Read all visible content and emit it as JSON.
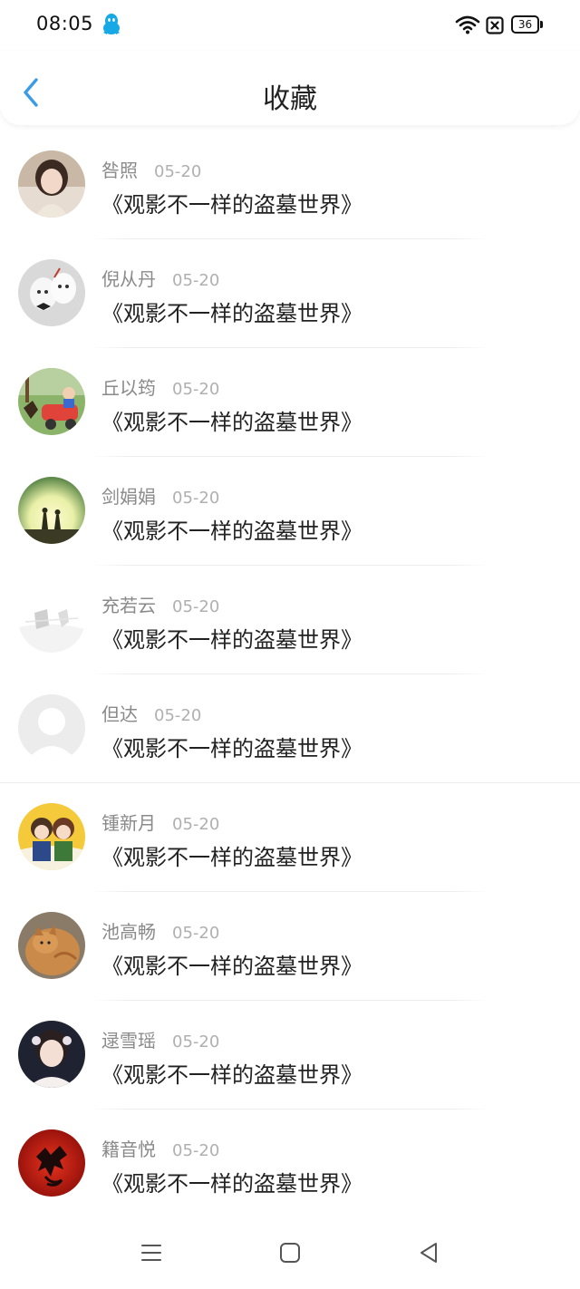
{
  "status_bar": {
    "time": "08:05",
    "battery": "36",
    "icons": [
      "qq-icon",
      "wifi-icon",
      "sim-card-icon",
      "battery-icon"
    ]
  },
  "header": {
    "title": "收藏",
    "back_icon": "chevron-left-icon",
    "accent_color": "#3a9ce8"
  },
  "favorites": [
    {
      "name": "咎照",
      "date": "05-20",
      "book": "《观影不一样的盗墓世界》",
      "avatar": "avatar-girl-photo"
    },
    {
      "name": "倪从丹",
      "date": "05-20",
      "book": "《观影不一样的盗墓世界》",
      "avatar": "avatar-eggs-photo"
    },
    {
      "name": "丘以筠",
      "date": "05-20",
      "book": "《观影不一样的盗墓世界》",
      "avatar": "avatar-kids-garden-photo"
    },
    {
      "name": "剑娟娟",
      "date": "05-20",
      "book": "《观影不一样的盗墓世界》",
      "avatar": "avatar-sunset-couple-photo"
    },
    {
      "name": "充若云",
      "date": "05-20",
      "book": "《观影不一样的盗墓世界》",
      "avatar": "avatar-snow-photo"
    },
    {
      "name": "但达",
      "date": "05-20",
      "book": "《观影不一样的盗墓世界》",
      "avatar": "avatar-default-person"
    },
    {
      "name": "锺新月",
      "date": "05-20",
      "book": "《观影不一样的盗墓世界》",
      "avatar": "avatar-anime-pair"
    },
    {
      "name": "池高畅",
      "date": "05-20",
      "book": "《观影不一样的盗墓世界》",
      "avatar": "avatar-cat-photo"
    },
    {
      "name": "逯雪瑶",
      "date": "05-20",
      "book": "《观影不一样的盗墓世界》",
      "avatar": "avatar-boy-photo"
    },
    {
      "name": "籍音悦",
      "date": "05-20",
      "book": "《观影不一样的盗墓世界》",
      "avatar": "avatar-dragon-emblem"
    }
  ],
  "nav_bar": {
    "buttons": [
      "menu-icon",
      "home-square-icon",
      "back-triangle-icon"
    ]
  }
}
